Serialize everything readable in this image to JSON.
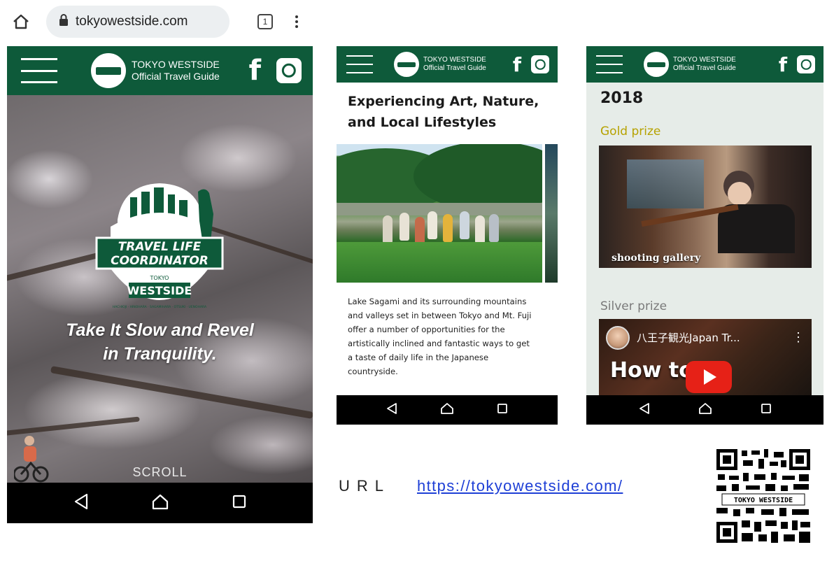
{
  "browser": {
    "url": "tokyowestside.com",
    "tab_count": "1"
  },
  "site": {
    "brand_line1": "TOKYO WESTSIDE",
    "brand_line2": "Official Travel Guide",
    "facebook_glyph": "f"
  },
  "hero": {
    "logo_line1": "TRAVEL LIFE",
    "logo_line2": "COORDINATOR",
    "logo_small": "TOKYO",
    "logo_big": "WESTSIDE",
    "logo_arc": "HACHIOJI · HINOHARA · SAGAMIHARA · OTSUKI · UENOHARA",
    "tagline_line1": "Take It Slow and Revel",
    "tagline_line2": "in Tranquility.",
    "scroll": "SCROLL"
  },
  "article": {
    "title_line1": "Experiencing Art, Nature,",
    "title_line2": "and Local Lifestyles",
    "body_lines": [
      "Lake Sagami and its surrounding mountains",
      "and valleys set in between Tokyo and Mt. Fuji",
      "offer a number of opportunities for the",
      "artistically inclined and fantastic ways to get",
      "a taste of daily life in the Japanese",
      "countryside."
    ]
  },
  "awards": {
    "year": "2018",
    "gold_label": "Gold prize",
    "gold_caption": "shooting gallery",
    "silver_label": "Silver prize",
    "video_title": "八王子観光Japan Tr...",
    "video_big_text": "How to t"
  },
  "footer": {
    "url_label": "URL",
    "url_link": "https://tokyowestside.com/",
    "qr_text": "TOKYO WESTSIDE"
  },
  "colors": {
    "brand_green": "#0e5a3a",
    "gold_label": "#b6a200",
    "link_blue": "#1e3fd6",
    "youtube_red": "#e62117"
  },
  "icons": {
    "home": "home-icon",
    "lock": "lock-icon",
    "tabs": "tabs-icon",
    "menu": "kebab-menu-icon",
    "hamburger": "hamburger-menu-icon",
    "facebook": "facebook-icon",
    "instagram": "instagram-icon",
    "back": "back-triangle-icon",
    "nav_home": "nav-home-icon",
    "recents": "recents-square-icon",
    "play": "play-icon"
  }
}
